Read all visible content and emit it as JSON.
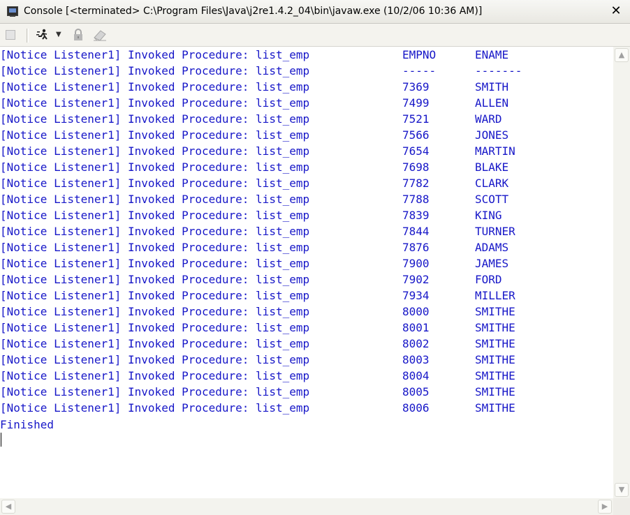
{
  "window": {
    "title": "Console [<terminated> C:\\Program Files\\Java\\j2re1.4.2_04\\bin\\javaw.exe (10/2/06 10:36 AM)]",
    "close_glyph": "✕"
  },
  "toolbar": {
    "buttons": [
      "terminate-icon",
      "display-selected-console-icon",
      "dropdown-icon",
      "scroll-lock-icon",
      "clear-console-icon"
    ],
    "dropdown_glyph": "▼"
  },
  "console": {
    "rows": [
      {
        "prefix": "[Notice Listener1] Invoked Procedure: list_emp",
        "col1": "EMPNO",
        "col2": "ENAME"
      },
      {
        "prefix": "[Notice Listener1] Invoked Procedure: list_emp",
        "col1": "-----",
        "col2": "-------"
      },
      {
        "prefix": "[Notice Listener1] Invoked Procedure: list_emp",
        "col1": "7369",
        "col2": "SMITH"
      },
      {
        "prefix": "[Notice Listener1] Invoked Procedure: list_emp",
        "col1": "7499",
        "col2": "ALLEN"
      },
      {
        "prefix": "[Notice Listener1] Invoked Procedure: list_emp",
        "col1": "7521",
        "col2": "WARD"
      },
      {
        "prefix": "[Notice Listener1] Invoked Procedure: list_emp",
        "col1": "7566",
        "col2": "JONES"
      },
      {
        "prefix": "[Notice Listener1] Invoked Procedure: list_emp",
        "col1": "7654",
        "col2": "MARTIN"
      },
      {
        "prefix": "[Notice Listener1] Invoked Procedure: list_emp",
        "col1": "7698",
        "col2": "BLAKE"
      },
      {
        "prefix": "[Notice Listener1] Invoked Procedure: list_emp",
        "col1": "7782",
        "col2": "CLARK"
      },
      {
        "prefix": "[Notice Listener1] Invoked Procedure: list_emp",
        "col1": "7788",
        "col2": "SCOTT"
      },
      {
        "prefix": "[Notice Listener1] Invoked Procedure: list_emp",
        "col1": "7839",
        "col2": "KING"
      },
      {
        "prefix": "[Notice Listener1] Invoked Procedure: list_emp",
        "col1": "7844",
        "col2": "TURNER"
      },
      {
        "prefix": "[Notice Listener1] Invoked Procedure: list_emp",
        "col1": "7876",
        "col2": "ADAMS"
      },
      {
        "prefix": "[Notice Listener1] Invoked Procedure: list_emp",
        "col1": "7900",
        "col2": "JAMES"
      },
      {
        "prefix": "[Notice Listener1] Invoked Procedure: list_emp",
        "col1": "7902",
        "col2": "FORD"
      },
      {
        "prefix": "[Notice Listener1] Invoked Procedure: list_emp",
        "col1": "7934",
        "col2": "MILLER"
      },
      {
        "prefix": "[Notice Listener1] Invoked Procedure: list_emp",
        "col1": "8000",
        "col2": "SMITHE"
      },
      {
        "prefix": "[Notice Listener1] Invoked Procedure: list_emp",
        "col1": "8001",
        "col2": "SMITHE"
      },
      {
        "prefix": "[Notice Listener1] Invoked Procedure: list_emp",
        "col1": "8002",
        "col2": "SMITHE"
      },
      {
        "prefix": "[Notice Listener1] Invoked Procedure: list_emp",
        "col1": "8003",
        "col2": "SMITHE"
      },
      {
        "prefix": "[Notice Listener1] Invoked Procedure: list_emp",
        "col1": "8004",
        "col2": "SMITHE"
      },
      {
        "prefix": "[Notice Listener1] Invoked Procedure: list_emp",
        "col1": "8005",
        "col2": "SMITHE"
      },
      {
        "prefix": "[Notice Listener1] Invoked Procedure: list_emp",
        "col1": "8006",
        "col2": "SMITHE"
      }
    ],
    "final_line": "Finished",
    "text_color": "#1717c8"
  },
  "scrollbars": {
    "up": "▲",
    "down": "▼",
    "left": "◀",
    "right": "▶"
  }
}
